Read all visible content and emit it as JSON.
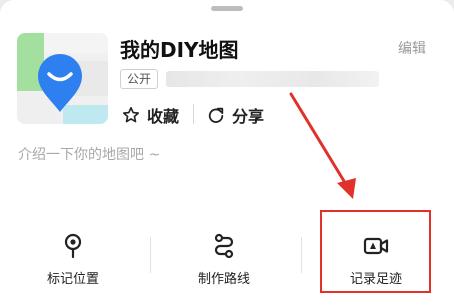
{
  "map": {
    "title": "我的DIY地图",
    "edit_label": "编辑",
    "visibility_badge": "公开",
    "collect_label": "收藏",
    "share_label": "分享",
    "intro_placeholder": "介绍一下你的地图吧 ~"
  },
  "tools": {
    "mark_location": "标记位置",
    "create_route": "制作路线",
    "record_footprint": "记录足迹"
  },
  "colors": {
    "annotation_red": "#e0312b",
    "brand_blue": "#2e7ff0",
    "map_green": "#9ddd9a",
    "map_cyan": "#bfe9f1"
  }
}
